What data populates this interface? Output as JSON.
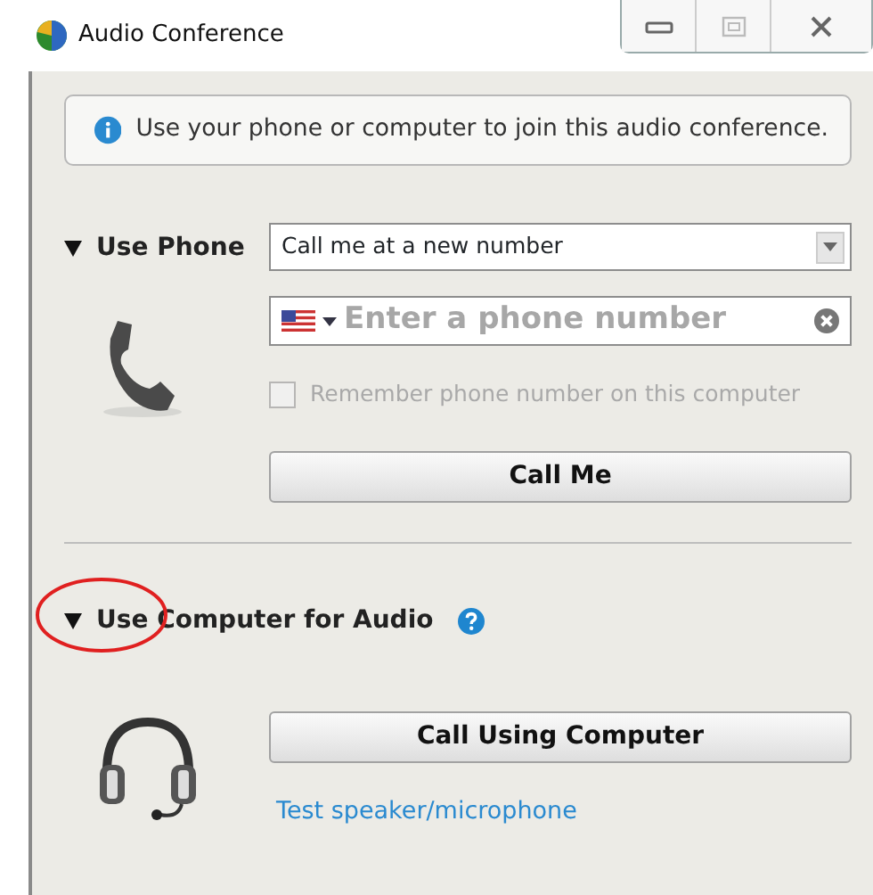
{
  "window": {
    "title": "Audio Conference",
    "controls": [
      {
        "kind": "minimize"
      },
      {
        "kind": "maximize",
        "disabled": true
      },
      {
        "kind": "close"
      }
    ]
  },
  "info": {
    "text": "Use your phone or computer to join this audio conference."
  },
  "phone_section": {
    "label": "Use Phone",
    "expanded": true,
    "dropdown": {
      "value": "Call me at a new number"
    },
    "phone_field": {
      "placeholder": "Enter a phone number"
    },
    "remember": {
      "label": "Remember phone number on this computer",
      "checked": false,
      "disabled": true
    },
    "button": "Call Me"
  },
  "computer_section": {
    "label": "Use Computer for Audio",
    "expanded": true,
    "highlighted": true,
    "button": "Call Using Computer",
    "link": "Test speaker/microphone"
  }
}
